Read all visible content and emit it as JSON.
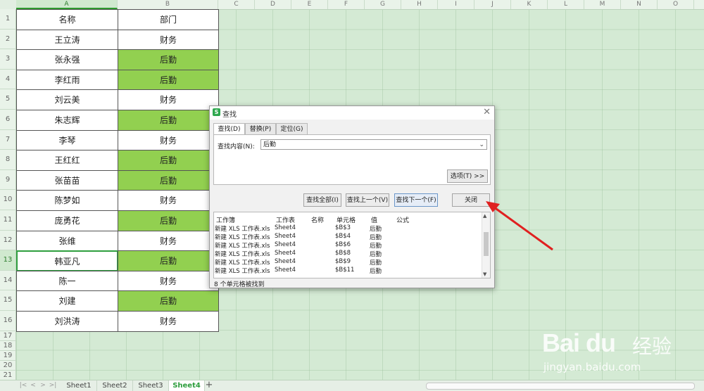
{
  "columns": [
    "A",
    "B",
    "C",
    "D",
    "E",
    "F",
    "G",
    "H",
    "I",
    "J",
    "K",
    "L",
    "M",
    "N",
    "O"
  ],
  "rows": [
    "1",
    "2",
    "3",
    "4",
    "5",
    "6",
    "7",
    "8",
    "9",
    "10",
    "11",
    "12",
    "13",
    "14",
    "15",
    "16",
    "17",
    "18",
    "19",
    "20",
    "21"
  ],
  "table": [
    {
      "name": "名称",
      "dept": "部门",
      "highlight": false
    },
    {
      "name": "王立涛",
      "dept": "财务",
      "highlight": false
    },
    {
      "name": "张永强",
      "dept": "后勤",
      "highlight": true
    },
    {
      "name": "李红雨",
      "dept": "后勤",
      "highlight": true
    },
    {
      "name": "刘云美",
      "dept": "财务",
      "highlight": false
    },
    {
      "name": "朱志辉",
      "dept": "后勤",
      "highlight": true
    },
    {
      "name": "李琴",
      "dept": "财务",
      "highlight": false
    },
    {
      "name": "王红红",
      "dept": "后勤",
      "highlight": true
    },
    {
      "name": "张苗苗",
      "dept": "后勤",
      "highlight": true
    },
    {
      "name": "陈梦如",
      "dept": "财务",
      "highlight": false
    },
    {
      "name": "庞勇花",
      "dept": "后勤",
      "highlight": true
    },
    {
      "name": "张维",
      "dept": "财务",
      "highlight": false
    },
    {
      "name": "韩亚凡",
      "dept": "后勤",
      "highlight": true
    },
    {
      "name": "陈一",
      "dept": "财务",
      "highlight": false
    },
    {
      "name": "刘建",
      "dept": "后勤",
      "highlight": true
    },
    {
      "name": "刘洪涛",
      "dept": "财务",
      "highlight": false
    }
  ],
  "sheets": [
    "Sheet1",
    "Sheet2",
    "Sheet3",
    "Sheet4"
  ],
  "active_sheet": "Sheet4",
  "add_sheet": "+",
  "nav_arrows": [
    "|<",
    "<",
    ">",
    ">|"
  ],
  "dialog": {
    "title": "查找",
    "logo": "S",
    "close": "✕",
    "tabs": [
      "查找(D)",
      "替换(P)",
      "定位(G)"
    ],
    "find_label": "查找内容(N):",
    "find_value": "后勤",
    "dropdown": "⌄",
    "options_btn": "选项(T) >>",
    "buttons": {
      "find_all": "查找全部(I)",
      "find_prev": "查找上一个(V)",
      "find_next": "查找下一个(F)",
      "close": "关闭"
    },
    "result_headers": [
      "工作簿",
      "工作表",
      "名称",
      "单元格",
      "值",
      "公式"
    ],
    "results": [
      {
        "book": "新建 XLS 工作表.xls",
        "sheet": "Sheet4",
        "cell": "$B$3",
        "value": "后勤"
      },
      {
        "book": "新建 XLS 工作表.xls",
        "sheet": "Sheet4",
        "cell": "$B$4",
        "value": "后勤"
      },
      {
        "book": "新建 XLS 工作表.xls",
        "sheet": "Sheet4",
        "cell": "$B$6",
        "value": "后勤"
      },
      {
        "book": "新建 XLS 工作表.xls",
        "sheet": "Sheet4",
        "cell": "$B$8",
        "value": "后勤"
      },
      {
        "book": "新建 XLS 工作表.xls",
        "sheet": "Sheet4",
        "cell": "$B$9",
        "value": "后勤"
      },
      {
        "book": "新建 XLS 工作表.xls",
        "sheet": "Sheet4",
        "cell": "$B$11",
        "value": "后勤"
      }
    ],
    "status": "8 个单元格被找到"
  },
  "colors": {
    "highlight": "#92d050",
    "sheet_bg": "#d4ead4",
    "active_border": "#2e9e3e",
    "arrow": "#e02020"
  },
  "watermark": {
    "logo": "Bai du",
    "cn": "经验",
    "url": "jingyan.baidu.com"
  }
}
